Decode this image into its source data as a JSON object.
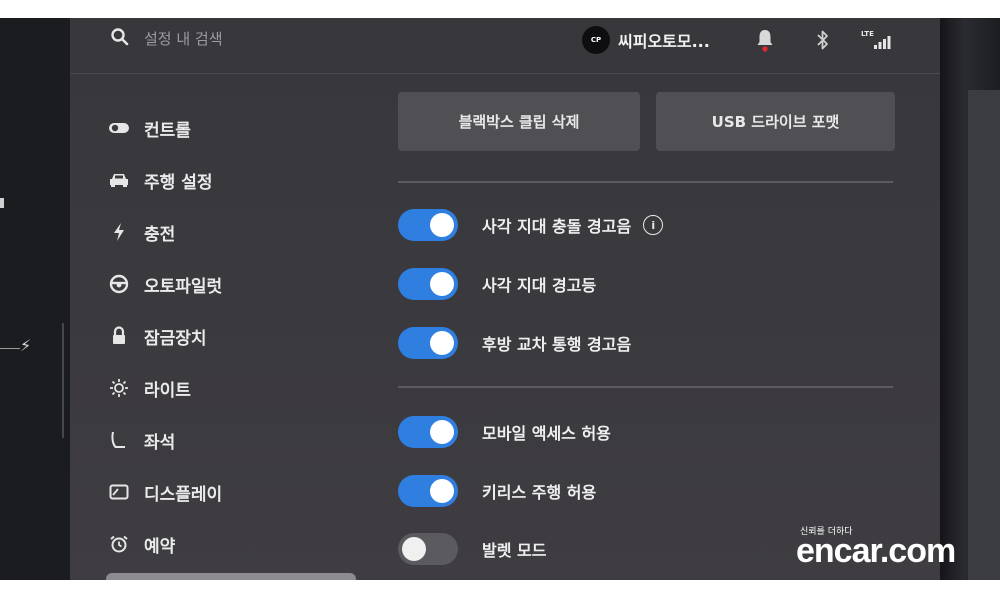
{
  "topbar": {
    "search_placeholder": "설정 내 검색",
    "profile_name": "씨피오토모...",
    "avatar_text": "CP",
    "icons": [
      "search-icon",
      "bell-icon",
      "bluetooth-icon",
      "lte-signal-icon"
    ],
    "lte_label": "LTE",
    "alert_color": "#e0282e"
  },
  "sidebar": {
    "items": [
      {
        "label": "컨트롤",
        "icon": "toggle-icon"
      },
      {
        "label": "주행 설정",
        "icon": "car-icon"
      },
      {
        "label": "충전",
        "icon": "lightning-icon"
      },
      {
        "label": "오토파일럿",
        "icon": "steering-wheel-icon"
      },
      {
        "label": "잠금장치",
        "icon": "lock-icon"
      },
      {
        "label": "라이트",
        "icon": "sun-icon"
      },
      {
        "label": "좌석",
        "icon": "seat-icon"
      },
      {
        "label": "디스플레이",
        "icon": "display-icon"
      },
      {
        "label": "예약",
        "icon": "alarm-clock-icon"
      }
    ]
  },
  "main": {
    "buttons": {
      "delete_dashcam_clips": "블랙박스 클립 삭제",
      "format_usb": "USB 드라이브 포맷"
    },
    "toggles": [
      {
        "label": "사각 지대 충돌 경고음",
        "on": true,
        "info": true
      },
      {
        "label": "사각 지대 경고등",
        "on": true
      },
      {
        "label": "후방 교차 통행 경고음",
        "on": true
      },
      {
        "label": "모바일 액세스 허용",
        "on": true
      },
      {
        "label": "키리스 주행 허용",
        "on": true
      },
      {
        "label": "발렛 모드",
        "on": false
      }
    ],
    "accent_color": "#2f7fe0"
  },
  "watermark": {
    "tagline": "신뢰를 더하다",
    "brand": "encar.com"
  }
}
